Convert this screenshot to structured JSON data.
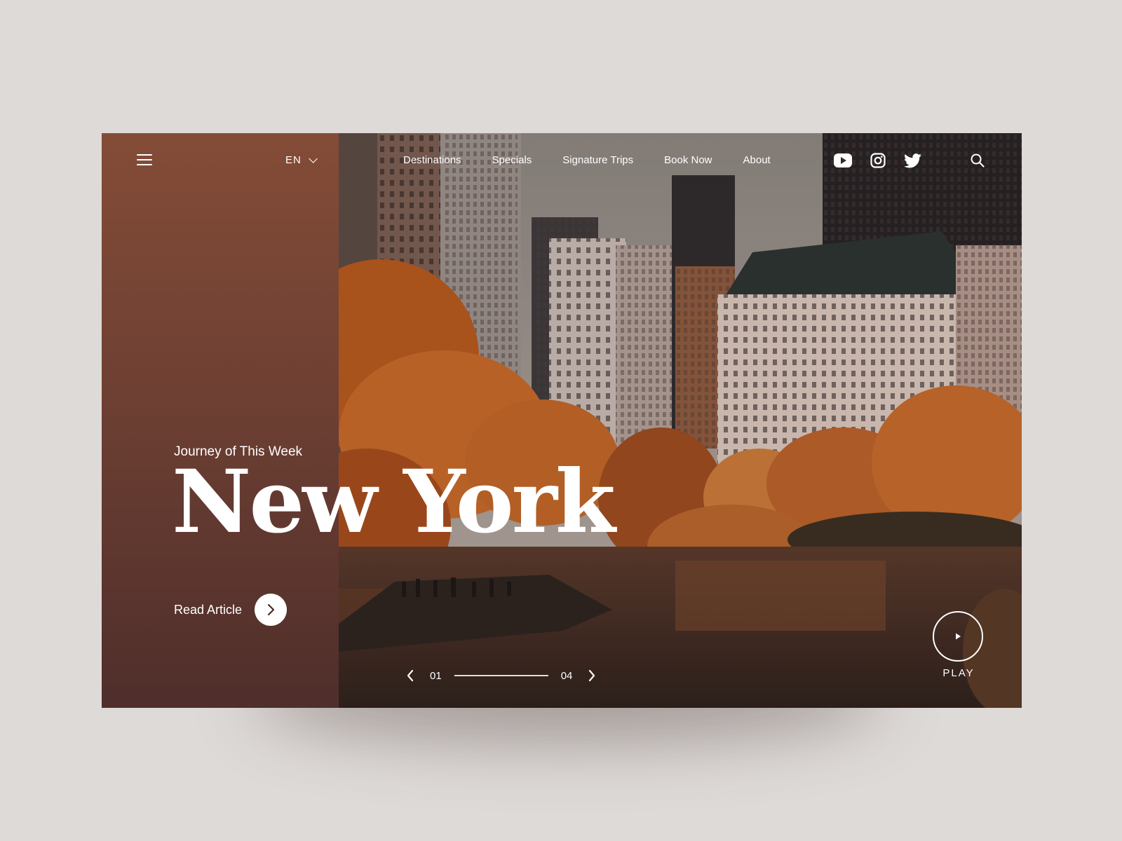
{
  "header": {
    "language": "EN",
    "nav": [
      "Destinations",
      "Specials",
      "Signature Trips",
      "Book Now",
      "About"
    ],
    "social_icons": [
      "youtube-icon",
      "instagram-icon",
      "twitter-icon"
    ],
    "search_icon": "search-icon"
  },
  "hero": {
    "eyebrow": "Journey of This Week",
    "title": "New York",
    "cta_label": "Read Article"
  },
  "slider": {
    "current": "01",
    "total": "04"
  },
  "player": {
    "play_label": "PLAY"
  },
  "colors": {
    "page_background": "#dedad8",
    "panel_top": "#844c37",
    "panel_bottom": "#4f2e2b",
    "text": "#ffffff"
  }
}
